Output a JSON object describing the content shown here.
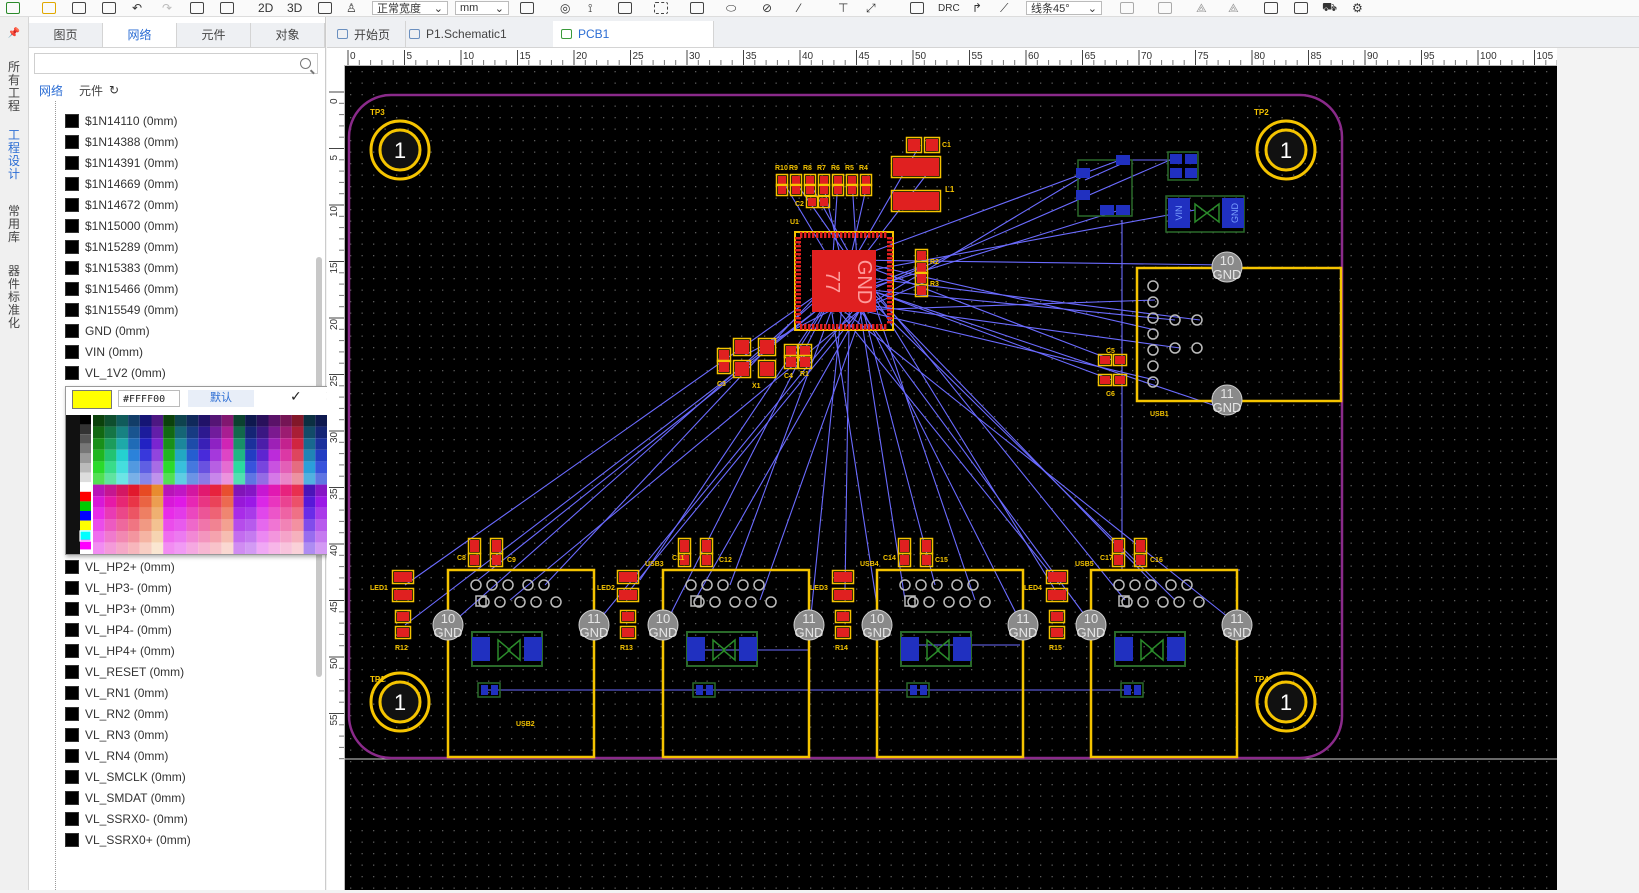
{
  "toolbar": {
    "view_2d": "2D",
    "view_3d": "3D",
    "line_width": "正常宽度",
    "unit": "mm",
    "drc": "DRC",
    "route_angle": "线条45°"
  },
  "vertical_tabs": [
    "所有工程",
    "工程设计",
    "常用库",
    "器件标准化"
  ],
  "panel": {
    "tabs": [
      "图页",
      "网络",
      "元件",
      "对象"
    ],
    "active_tab": "网络",
    "search_placeholder": "",
    "subtabs": [
      "网络",
      "元件"
    ],
    "nets": [
      "$1N14110 (0mm)",
      "$1N14388 (0mm)",
      "$1N14391 (0mm)",
      "$1N14669 (0mm)",
      "$1N14672 (0mm)",
      "$1N15000 (0mm)",
      "$1N15289 (0mm)",
      "$1N15383 (0mm)",
      "$1N15466 (0mm)",
      "$1N15549 (0mm)",
      "GND (0mm)",
      "VIN (0mm)",
      "VL_1V2 (0mm)",
      "VL_HP2+ (0mm)",
      "VL_HP3- (0mm)",
      "VL_HP3+ (0mm)",
      "VL_HP4- (0mm)",
      "VL_HP4+ (0mm)",
      "VL_RESET (0mm)",
      "VL_RN1 (0mm)",
      "VL_RN2 (0mm)",
      "VL_RN3 (0mm)",
      "VL_RN4 (0mm)",
      "VL_SMCLK (0mm)",
      "VL_SMDAT (0mm)",
      "VL_SSRX0- (0mm)",
      "VL_SSRX0+ (0mm)"
    ]
  },
  "color_picker": {
    "color": "#FFFF00",
    "hex_value": "#FFFF00",
    "default_label": "默认",
    "confirm_icon": "check-icon",
    "close_icon": "close-icon"
  },
  "doc_tabs": [
    "开始页",
    "P1.Schematic1",
    "PCB1"
  ],
  "active_doc": "PCB1",
  "ruler": {
    "top_labels": [
      "0",
      "5",
      "10",
      "15",
      "20",
      "25",
      "30",
      "35",
      "40",
      "45",
      "50",
      "55",
      "60",
      "65",
      "70",
      "75",
      "80",
      "85",
      "90",
      "95",
      "100",
      "105"
    ],
    "left_labels": [
      "0",
      "5",
      "10",
      "15",
      "20",
      "25",
      "30",
      "35",
      "40",
      "45",
      "50",
      "55"
    ]
  },
  "pcb": {
    "board_outline_color": "#8a2a8a",
    "ratsnest_color": "#6b6bff",
    "silkscreen_color": "#f5c400",
    "pad_color": "#e02020",
    "bottom_pad_color": "#2030c0",
    "mounting_holes": [
      "TP1",
      "TP2",
      "TP3",
      "TP4"
    ],
    "mounting_pin": "1",
    "usb_labels": [
      "USB1",
      "USB2",
      "USB3",
      "USB4",
      "USB5"
    ],
    "gnd_label": "GND",
    "pin10": "10",
    "pin11": "11",
    "ic_label": "GND",
    "ic_number": "77",
    "ref_top": [
      "R10",
      "R9",
      "R8",
      "R7",
      "R6",
      "R5",
      "R4"
    ],
    "misc_labels": [
      "C1",
      "L1",
      "C2",
      "U1",
      "R2",
      "R3",
      "C3",
      "X1",
      "C4",
      "R1",
      "C5",
      "C6",
      "C8",
      "C9",
      "C11",
      "C12",
      "C14",
      "C15",
      "C17",
      "C16",
      "LED1",
      "LED2",
      "LED3",
      "LED4",
      "R12",
      "R13",
      "R14",
      "R15",
      "VIN",
      "GND"
    ]
  }
}
